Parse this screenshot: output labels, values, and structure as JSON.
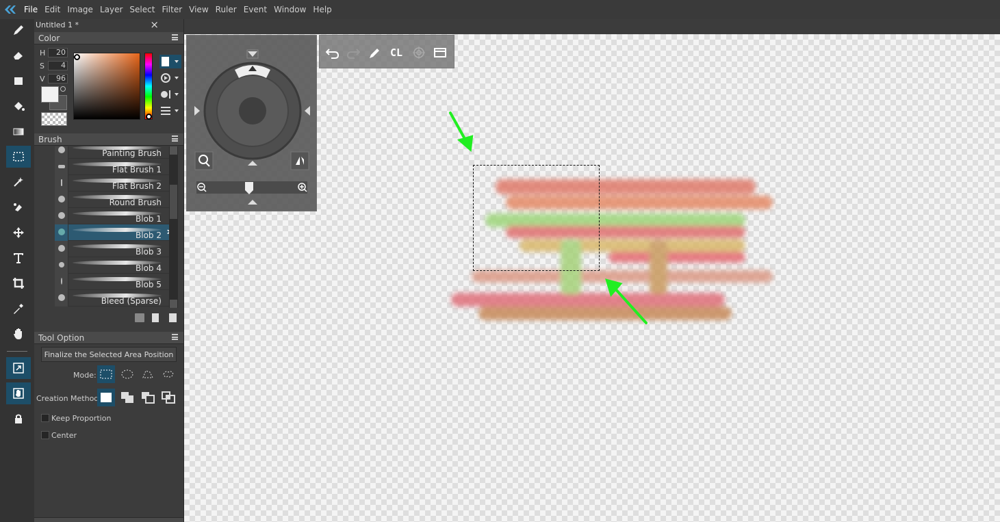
{
  "menubar": {
    "items": [
      "File",
      "Edit",
      "Image",
      "Layer",
      "Select",
      "Filter",
      "View",
      "Ruler",
      "Event",
      "Window",
      "Help"
    ]
  },
  "document": {
    "tab_title": "Untitled 1 *",
    "close": "×"
  },
  "color_panel": {
    "title": "Color",
    "h_label": "H",
    "h_value": "20",
    "s_label": "S",
    "s_value": "4",
    "v_label": "V",
    "v_value": "96"
  },
  "brush_panel": {
    "title": "Brush",
    "brushes": [
      "Painting Brush",
      "Flat Brush 1",
      "Flat Brush 2",
      "Round Brush",
      "Blob 1",
      "Blob 2",
      "Blob 3",
      "Blob 4",
      "Blob 5",
      "Bleed (Sparse)"
    ],
    "selected": "Blob 2"
  },
  "tool_option": {
    "title": "Tool Option",
    "finalize_label": "Finalize the Selected Area Position",
    "mode_label": "Mode:",
    "creation_label": "Creation Method:",
    "keep_proportion": "Keep Proportion",
    "center": "Center"
  },
  "quickbar": {
    "cl_label": "CL"
  },
  "colors": {
    "accent": "#1d4e68",
    "annotation_arrow": "#22ee22"
  }
}
